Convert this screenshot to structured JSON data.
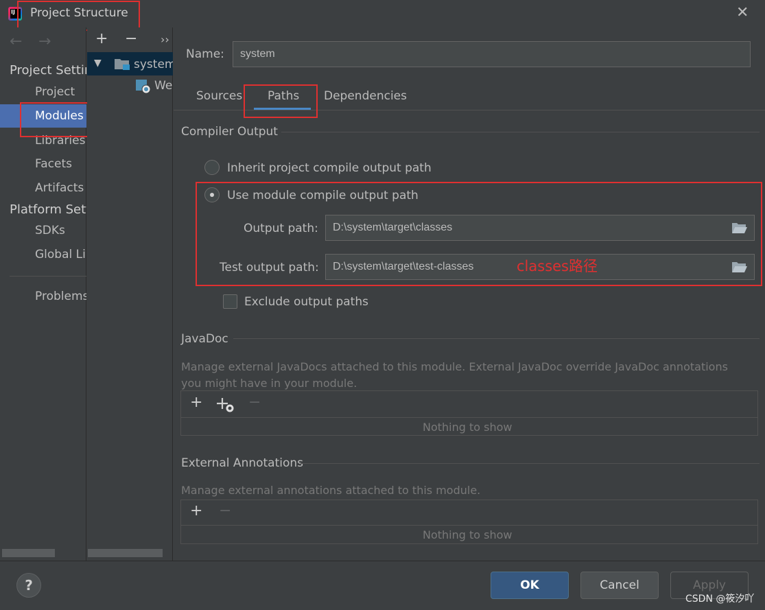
{
  "window": {
    "title": "Project Structure",
    "close_glyph": "✕"
  },
  "left_nav": {
    "back_glyph": "←",
    "forward_glyph": "→",
    "project_settings_header": "Project Settings",
    "project_settings_items": [
      {
        "label": "Project"
      },
      {
        "label": "Modules"
      },
      {
        "label": "Libraries"
      },
      {
        "label": "Facets"
      },
      {
        "label": "Artifacts"
      }
    ],
    "platform_settings_header": "Platform Settings",
    "platform_settings_items": [
      {
        "label": "SDKs"
      },
      {
        "label": "Global Libraries"
      }
    ],
    "problems_label": "Problems",
    "selected": "Modules"
  },
  "module_tree": {
    "add_glyph": "+",
    "remove_glyph": "−",
    "more_glyph": "››",
    "expand_glyph": "▼",
    "items": [
      {
        "label": "system",
        "icon": "module-folder-icon"
      },
      {
        "label": "Web",
        "icon": "web-facet-icon"
      }
    ]
  },
  "module_editor": {
    "name_label": "Name:",
    "name_value": "system",
    "tabs": [
      {
        "label": "Sources"
      },
      {
        "label": "Paths"
      },
      {
        "label": "Dependencies"
      }
    ],
    "active_tab": "Paths",
    "compiler_output": {
      "title": "Compiler Output",
      "inherit_label": "Inherit project compile output path",
      "use_module_label": "Use module compile output path",
      "selected": "use_module",
      "output_path_label": "Output path:",
      "output_path_value": "D:\\system\\target\\classes",
      "test_output_path_label": "Test output path:",
      "test_output_path_value": "D:\\system\\target\\test-classes",
      "exclude_label": "Exclude output paths",
      "exclude_checked": false
    },
    "javadoc": {
      "title": "JavaDoc",
      "description": "Manage external JavaDocs attached to this module. External JavaDoc override JavaDoc annotations you might have in your module.",
      "add_glyph": "+",
      "remove_glyph": "−",
      "empty_text": "Nothing to show"
    },
    "external_annotations": {
      "title": "External Annotations",
      "description": "Manage external annotations attached to this module.",
      "add_glyph": "+",
      "remove_glyph": "−",
      "empty_text": "Nothing to show"
    }
  },
  "footer": {
    "help_label": "?",
    "ok_label": "OK",
    "cancel_label": "Cancel",
    "apply_label": "Apply"
  },
  "annotation_text": "classes路径",
  "watermark": "CSDN @筱汐吖",
  "colors": {
    "background": "#3c3f41",
    "selection": "#4b6eaf",
    "annotation_red": "#e03030",
    "ok_button": "#365880",
    "tab_underline": "#4a88c7"
  }
}
